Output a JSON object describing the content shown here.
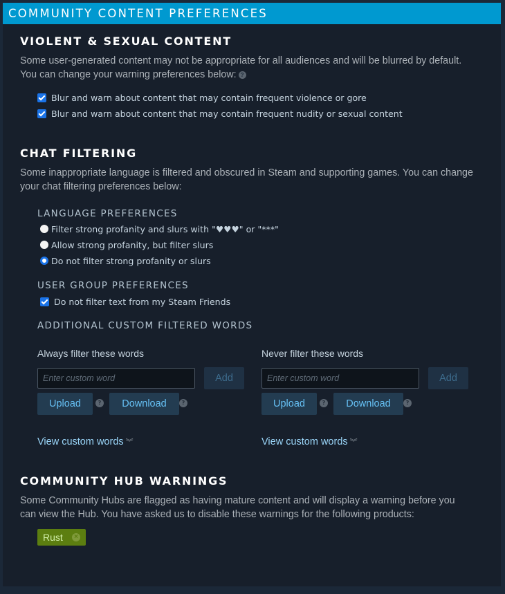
{
  "header": {
    "title": "Community Content Preferences"
  },
  "violent": {
    "title": "Violent & Sexual Content",
    "desc_line1": "Some user-generated content may not be appropriate for all audiences and will be blurred by default.",
    "desc_line2": "You can change your warning preferences below:",
    "help_glyph": "?",
    "options": [
      {
        "label": "Blur and warn about content that may contain frequent violence or gore",
        "checked": true
      },
      {
        "label": "Blur and warn about content that may contain frequent nudity or sexual content",
        "checked": true
      }
    ]
  },
  "chat": {
    "title": "Chat Filtering",
    "desc_line1": "Some inappropriate language is filtered and obscured in Steam and supporting games. You can change",
    "desc_line2": "your chat filtering preferences below:",
    "language": {
      "title": "Language Preferences",
      "options": [
        {
          "label": "Filter strong profanity and slurs with \"♥♥♥\" or \"***\"",
          "selected": false
        },
        {
          "label": "Allow strong profanity, but filter slurs",
          "selected": false
        },
        {
          "label": "Do not filter strong profanity or slurs",
          "selected": true
        }
      ]
    },
    "user_group": {
      "title": "User Group Preferences",
      "option": {
        "label": "Do not filter text from my Steam Friends",
        "checked": true
      }
    },
    "custom": {
      "title": "Additional Custom Filtered Words",
      "always": {
        "label": "Always filter these words",
        "placeholder": "Enter custom word",
        "value": "",
        "add": "Add",
        "upload": "Upload",
        "download": "Download",
        "view": "View custom words"
      },
      "never": {
        "label": "Never filter these words",
        "placeholder": "Enter custom word",
        "value": "",
        "add": "Add",
        "upload": "Upload",
        "download": "Download",
        "view": "View custom words"
      },
      "help_glyph": "?",
      "chevron_glyph": "︾"
    }
  },
  "hub": {
    "title": "Community Hub Warnings",
    "desc_line1": "Some Community Hubs are flagged as having mature content and will display a warning before you",
    "desc_line2": "can view the Hub. You have asked us to disable these warnings for the following products:",
    "products": [
      {
        "name": "Rust",
        "remove_glyph": "×"
      }
    ]
  },
  "colors": {
    "header_bg": "#0099d0",
    "panel_bg": "#171f2b",
    "page_bg": "#1b2838",
    "checkbox": "#1a73e8",
    "button_text": "#66c0f4",
    "tag_bg": "#5c7e10"
  }
}
